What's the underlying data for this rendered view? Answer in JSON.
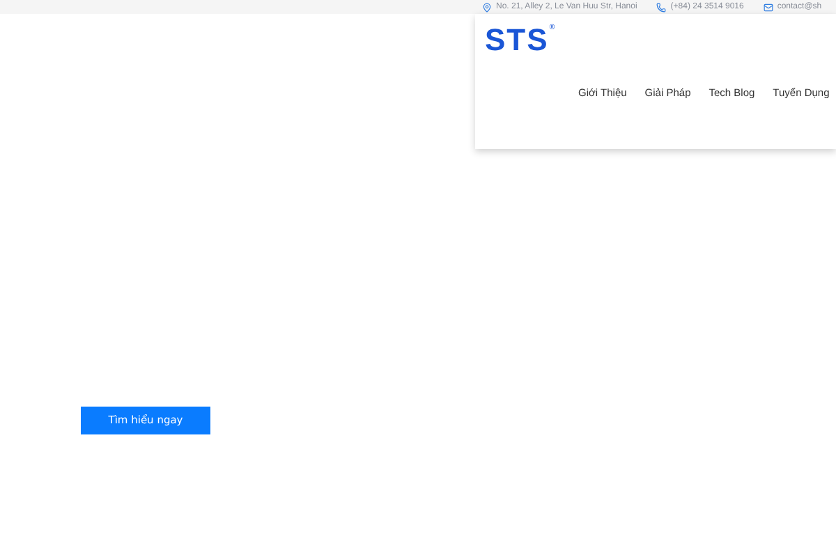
{
  "top_bar": {
    "items": [
      {
        "kind": "address",
        "text": "No. 21, Alley 2, Le Van Huu Str, Hanoi"
      },
      {
        "kind": "phone",
        "text": "(+84) 24 3514 9016"
      },
      {
        "kind": "email",
        "text": "contact@sh"
      }
    ]
  },
  "header": {
    "logo": {
      "text": "STS",
      "mark": "®"
    },
    "nav": [
      {
        "label": "Giới Thiệu"
      },
      {
        "label": "Giải Pháp"
      },
      {
        "label": "Tech Blog"
      },
      {
        "label": "Tuyển Dụng"
      }
    ]
  },
  "hero": {
    "button": "Tìm hiểu ngay"
  }
}
